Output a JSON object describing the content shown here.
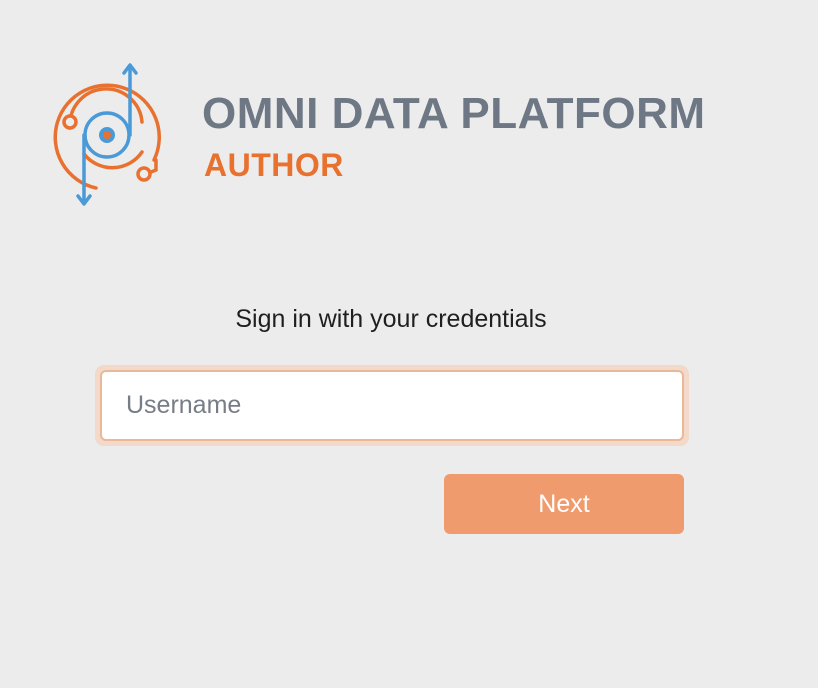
{
  "brand": {
    "title": "OMNI DATA PLATFORM",
    "subtitle": "AUTHOR",
    "logo_icon": "omni-data-platform-logo-icon"
  },
  "login": {
    "heading": "Sign in with your credentials",
    "username_placeholder": "Username",
    "username_value": "",
    "next_label": "Next"
  },
  "colors": {
    "background": "#ececec",
    "title_gray": "#6e7784",
    "accent_orange": "#e9712f",
    "button_orange": "#f09b6e",
    "logo_blue": "#4a9ad8"
  }
}
